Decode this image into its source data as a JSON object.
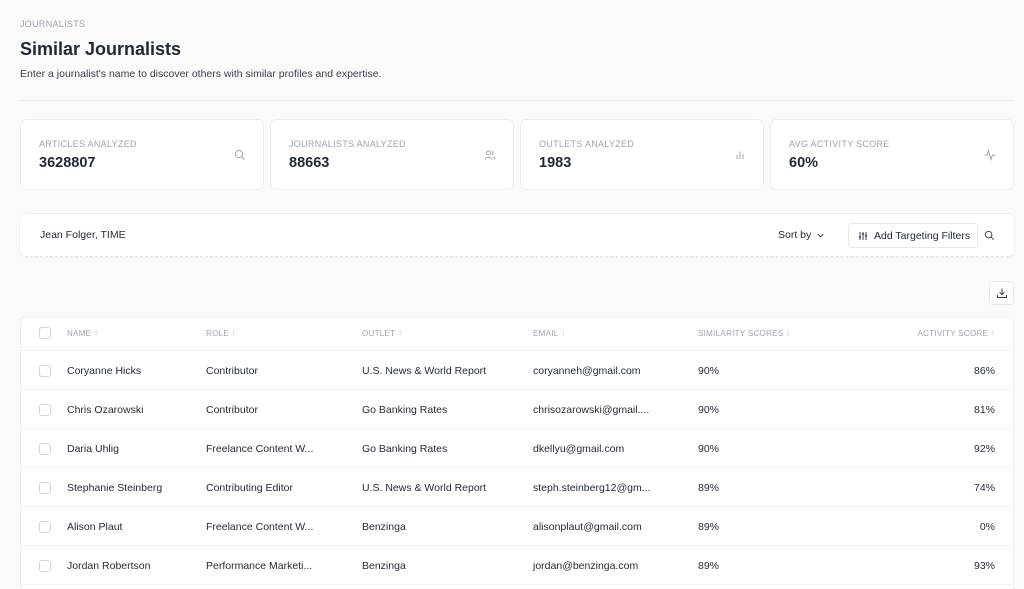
{
  "header": {
    "breadcrumb": "JOURNALISTS",
    "title": "Similar Journalists",
    "subtitle": "Enter a journalist's name to discover others with similar profiles and expertise."
  },
  "stats": [
    {
      "label": "ARTICLES ANALYZED",
      "value": "3628807",
      "icon": "search-icon"
    },
    {
      "label": "JOURNALISTS ANALYZED",
      "value": "88663",
      "icon": "users-icon"
    },
    {
      "label": "OUTLETS ANALYZED",
      "value": "1983",
      "icon": "bar-chart-icon"
    },
    {
      "label": "AVG ACTIVITY SCORE",
      "value": "60%",
      "icon": "activity-icon"
    }
  ],
  "search": {
    "value": "Jean Folger, TIME",
    "sort_label": "Sort by",
    "filters_label": "Add Targeting Filters"
  },
  "table": {
    "columns": [
      "NAME",
      "ROLE",
      "OUTLET",
      "EMAIL",
      "SIMILARITY SCORES",
      "ACTIVITY SCORE"
    ],
    "rows": [
      {
        "name": "Coryanne Hicks",
        "role": "Contributor",
        "outlet": "U.S. News & World Report",
        "email": "coryanneh@gmail.com",
        "similarity": "90%",
        "activity": "86%"
      },
      {
        "name": "Chris Ozarowski",
        "role": "Contributor",
        "outlet": "Go Banking Rates",
        "email": "chrisozarowski@gmail....",
        "similarity": "90%",
        "activity": "81%"
      },
      {
        "name": "Daria Uhlig",
        "role": "Freelance Content W...",
        "outlet": "Go Banking Rates",
        "email": "dkellyu@gmail.com",
        "similarity": "90%",
        "activity": "92%"
      },
      {
        "name": "Stephanie Steinberg",
        "role": "Contributing Editor",
        "outlet": "U.S. News & World Report",
        "email": "steph.steinberg12@gm...",
        "similarity": "89%",
        "activity": "74%"
      },
      {
        "name": "Alison Plaut",
        "role": "Freelance Content W...",
        "outlet": "Benzinga",
        "email": "alisonplaut@gmail.com",
        "similarity": "89%",
        "activity": "0%"
      },
      {
        "name": "Jordan Robertson",
        "role": "Performance Marketi...",
        "outlet": "Benzinga",
        "email": "jordan@benzinga.com",
        "similarity": "89%",
        "activity": "93%"
      }
    ]
  }
}
